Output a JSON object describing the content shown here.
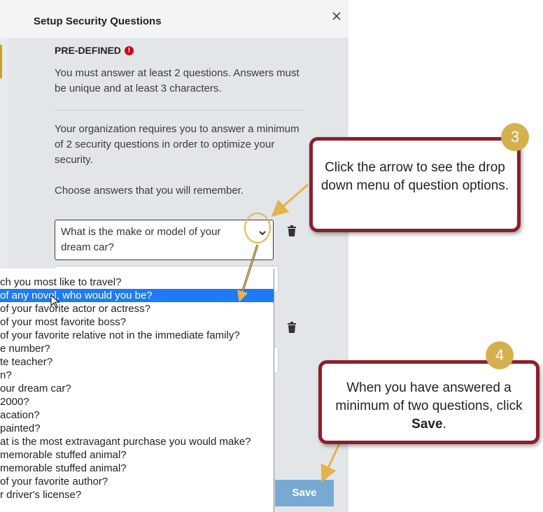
{
  "dialog": {
    "title": "Setup Security Questions",
    "section_title": "PRE-DEFINED",
    "alert_glyph": "!",
    "instruction": "You must answer at least 2 questions. Answers must be unique and at least 3 characters.",
    "requirement": "Your organization requires you to answer a minimum of 2 security questions in order to optimize your security.",
    "hint": "Choose answers that you will remember.",
    "selected_question": "What is the make or model of your dream car?",
    "save_label": "Save"
  },
  "dropdown": {
    "options": [
      "ch you most like to travel?",
      "of any novel, who would you be?",
      "of your favorite actor or actress?",
      "of your most favorite boss?",
      "of your favorite relative not in the immediate family?",
      "e number?",
      "te teacher?",
      "n?",
      "our dream car?",
      "2000?",
      "acation?",
      "painted?",
      "at is the most extravagant purchase you would make?",
      "memorable stuffed animal?",
      "memorable stuffed animal?",
      "of your favorite author?",
      "r driver's license?"
    ],
    "selected_index": 1
  },
  "callouts": {
    "step3": {
      "number": "3",
      "text": "Click the arrow to see the drop down menu of question options."
    },
    "step4": {
      "number": "4",
      "text_before": "When you have answered a minimum of two questions, click ",
      "text_bold": "Save",
      "text_after": "."
    }
  },
  "colors": {
    "accent_blue": "#1e7bf5",
    "save_button": "#77a9d2",
    "callout_border": "#8b1f2b",
    "badge_gold": "#d5b04f",
    "alert_red": "#d0021b"
  }
}
